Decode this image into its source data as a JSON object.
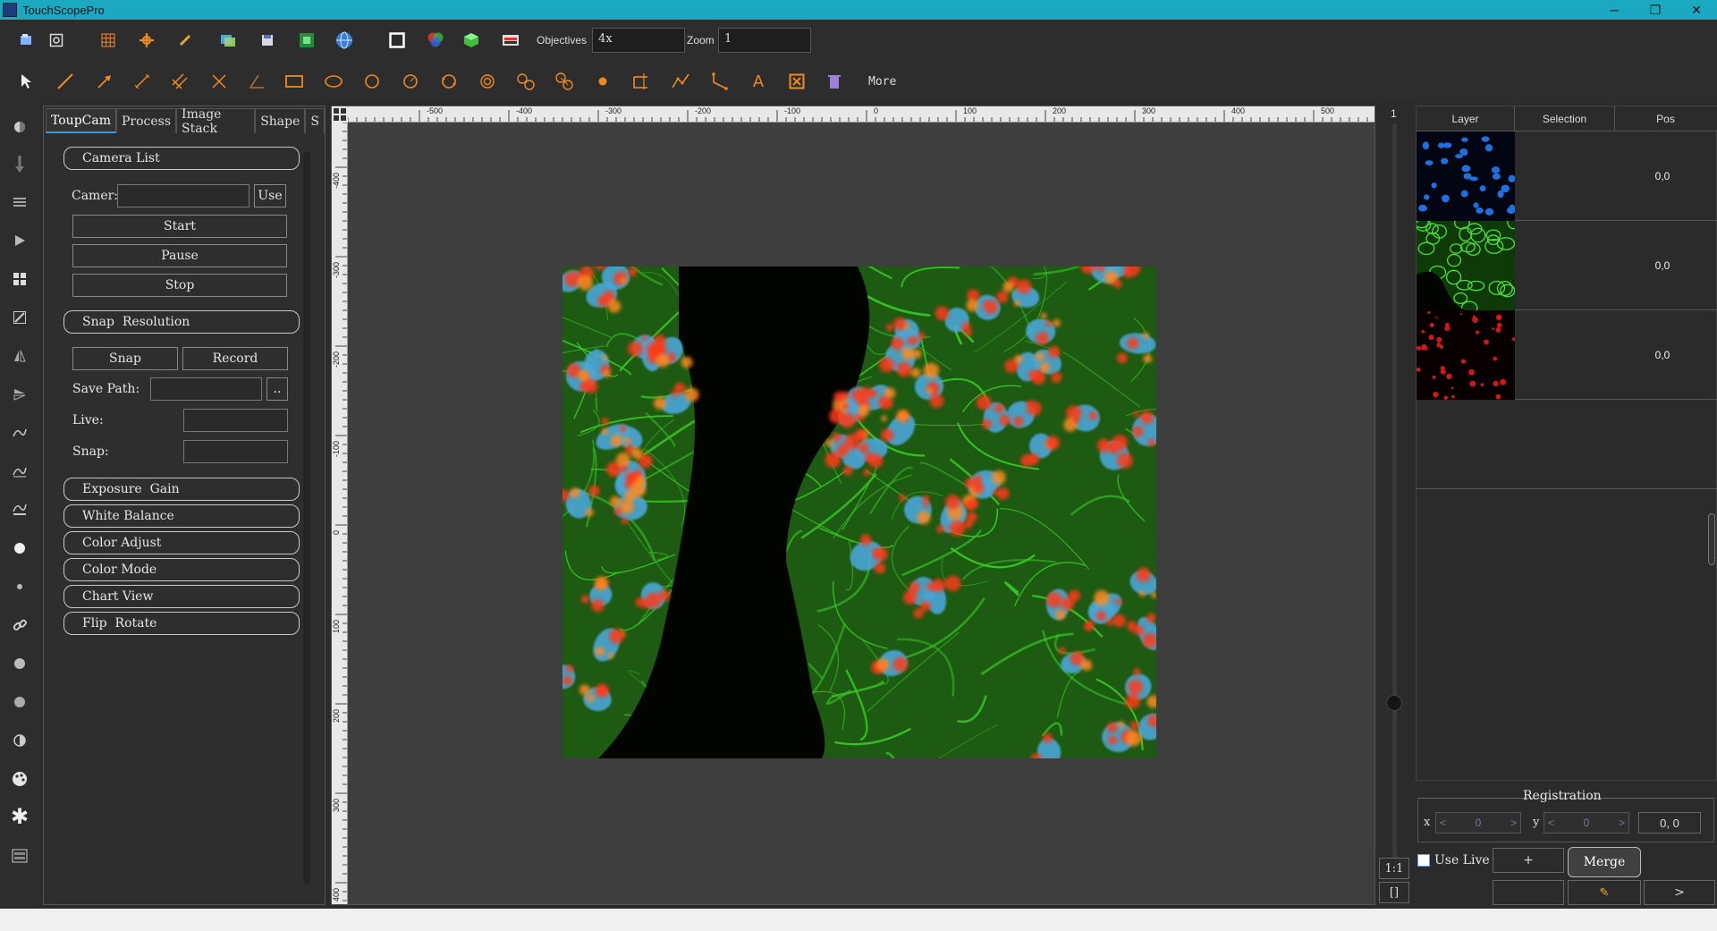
{
  "window": {
    "title": "TouchScopePro",
    "minimize": "─",
    "restore": "❐",
    "close": "✕"
  },
  "toolbar1": {
    "objectives_label": "Objectives",
    "objectives_value": "4x",
    "zoom_label": "Zoom",
    "zoom_value": "1"
  },
  "toolbar2": {
    "more_label": "More"
  },
  "tabs": [
    {
      "label": "ToupCam",
      "active": true
    },
    {
      "label": "Process"
    },
    {
      "label": "Image Stack"
    },
    {
      "label": "Shape"
    },
    {
      "label": "S"
    }
  ],
  "camera_panel": {
    "camera_list": "Camera List",
    "camera_label": "Camer:",
    "use_label": "Use",
    "start": "Start",
    "pause": "Pause",
    "stop": "Stop",
    "snap_resolution": "Snap  Resolution",
    "snap": "Snap",
    "record": "Record",
    "save_path_label": "Save Path:",
    "browse": "..",
    "live_label": "Live:",
    "snap_label": "Snap:",
    "exposure_gain": "Exposure  Gain",
    "white_balance": "White Balance",
    "color_adjust": "Color Adjust",
    "color_mode": "Color Mode",
    "chart_view": "Chart View",
    "flip_rotate": "Flip  Rotate"
  },
  "ruler": {
    "h_ticks": [
      "-500",
      "-400",
      "-300",
      "-200",
      "-100",
      "0",
      "100",
      "200",
      "300",
      "400",
      "500"
    ],
    "v_ticks": [
      "-400",
      "-300",
      "-200",
      "-100",
      "0",
      "100",
      "200",
      "300",
      "400"
    ]
  },
  "zoom_slider": {
    "top_label": "1",
    "one_to_one": "1:1",
    "fit": "[]"
  },
  "layers": {
    "headers": [
      "Layer",
      "Selection",
      "Pos"
    ],
    "rows": [
      {
        "pos": "0,0",
        "channel": "blue"
      },
      {
        "pos": "0,0",
        "channel": "green"
      },
      {
        "pos": "0,0",
        "channel": "red"
      }
    ]
  },
  "registration": {
    "title": "Registration",
    "x_label": "x",
    "y_label": "y",
    "x_value": "0",
    "y_value": "0",
    "offset": "0, 0"
  },
  "controls": {
    "use_live": "Use Live",
    "plus": "+",
    "merge": "Merge",
    "next": ">"
  }
}
